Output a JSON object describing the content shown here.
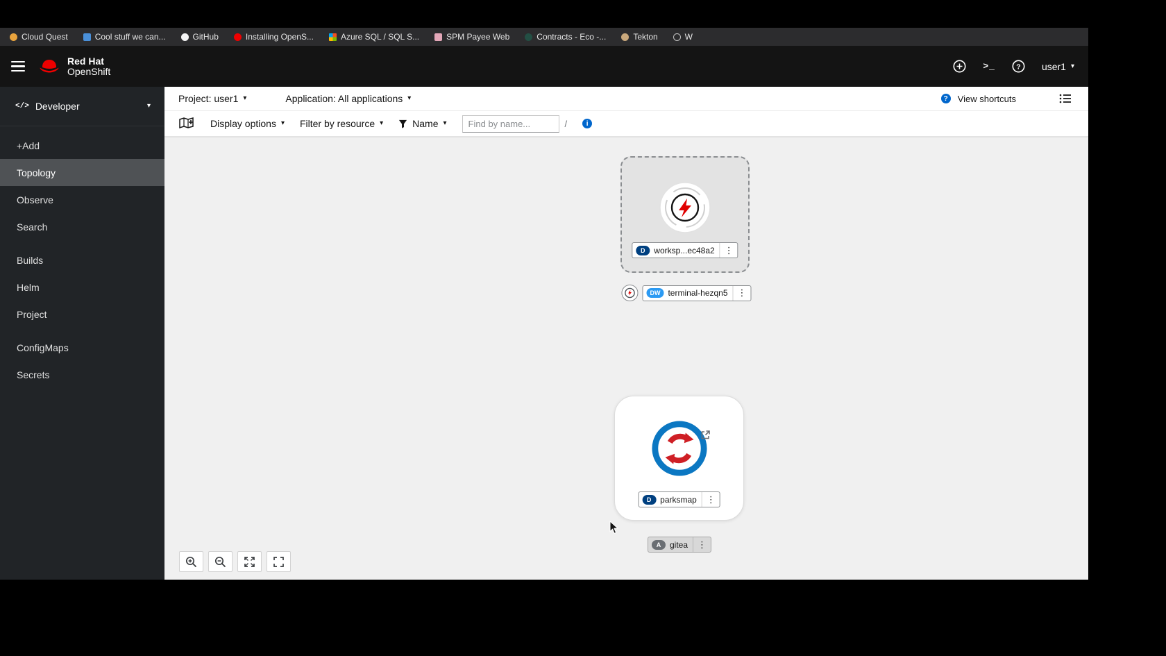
{
  "colors": {
    "badge_deployment": "#004080",
    "badge_devworkspace": "#2b9af3",
    "badge_application": "#6a6e73",
    "accent_blue": "#0066cc",
    "brand_red": "#ee0000"
  },
  "icons": {
    "caret": "▾",
    "kebab": "⋮",
    "code": "</>",
    "question": "?",
    "info": "i",
    "terminal_prompt": ">_"
  },
  "bookmarks": {
    "items": [
      {
        "label": "Cloud Quest"
      },
      {
        "label": "Cool stuff we can..."
      },
      {
        "label": "GitHub"
      },
      {
        "label": "Installing OpenS..."
      },
      {
        "label": "Azure SQL / SQL S..."
      },
      {
        "label": "SPM Payee Web"
      },
      {
        "label": "Contracts - Eco -..."
      },
      {
        "label": "Tekton"
      },
      {
        "label": "W"
      }
    ]
  },
  "masthead": {
    "brand_line1": "Red Hat",
    "brand_line2": "OpenShift",
    "user": "user1"
  },
  "sidebar": {
    "perspective": "Developer",
    "items": [
      {
        "label": "+Add"
      },
      {
        "label": "Topology"
      },
      {
        "label": "Observe"
      },
      {
        "label": "Search"
      },
      {
        "label": "Builds"
      },
      {
        "label": "Helm"
      },
      {
        "label": "Project"
      },
      {
        "label": "ConfigMaps"
      },
      {
        "label": "Secrets"
      }
    ]
  },
  "project_bar": {
    "project": "Project: user1",
    "application": "Application: All applications",
    "view_shortcuts": "View shortcuts"
  },
  "filter_bar": {
    "display_options": "Display options",
    "filter_by_resource": "Filter by resource",
    "name_filter": "Name",
    "find_placeholder": "Find by name...",
    "slash_hint": "/"
  },
  "topology": {
    "nodes": {
      "workspace": {
        "badge": "D",
        "label": "worksp...ec48a2"
      },
      "terminal": {
        "badge": "DW",
        "label": "terminal-hezqn5"
      },
      "parksmap": {
        "badge": "D",
        "label": "parksmap"
      },
      "gitea": {
        "badge": "A",
        "label": "gitea"
      }
    }
  }
}
